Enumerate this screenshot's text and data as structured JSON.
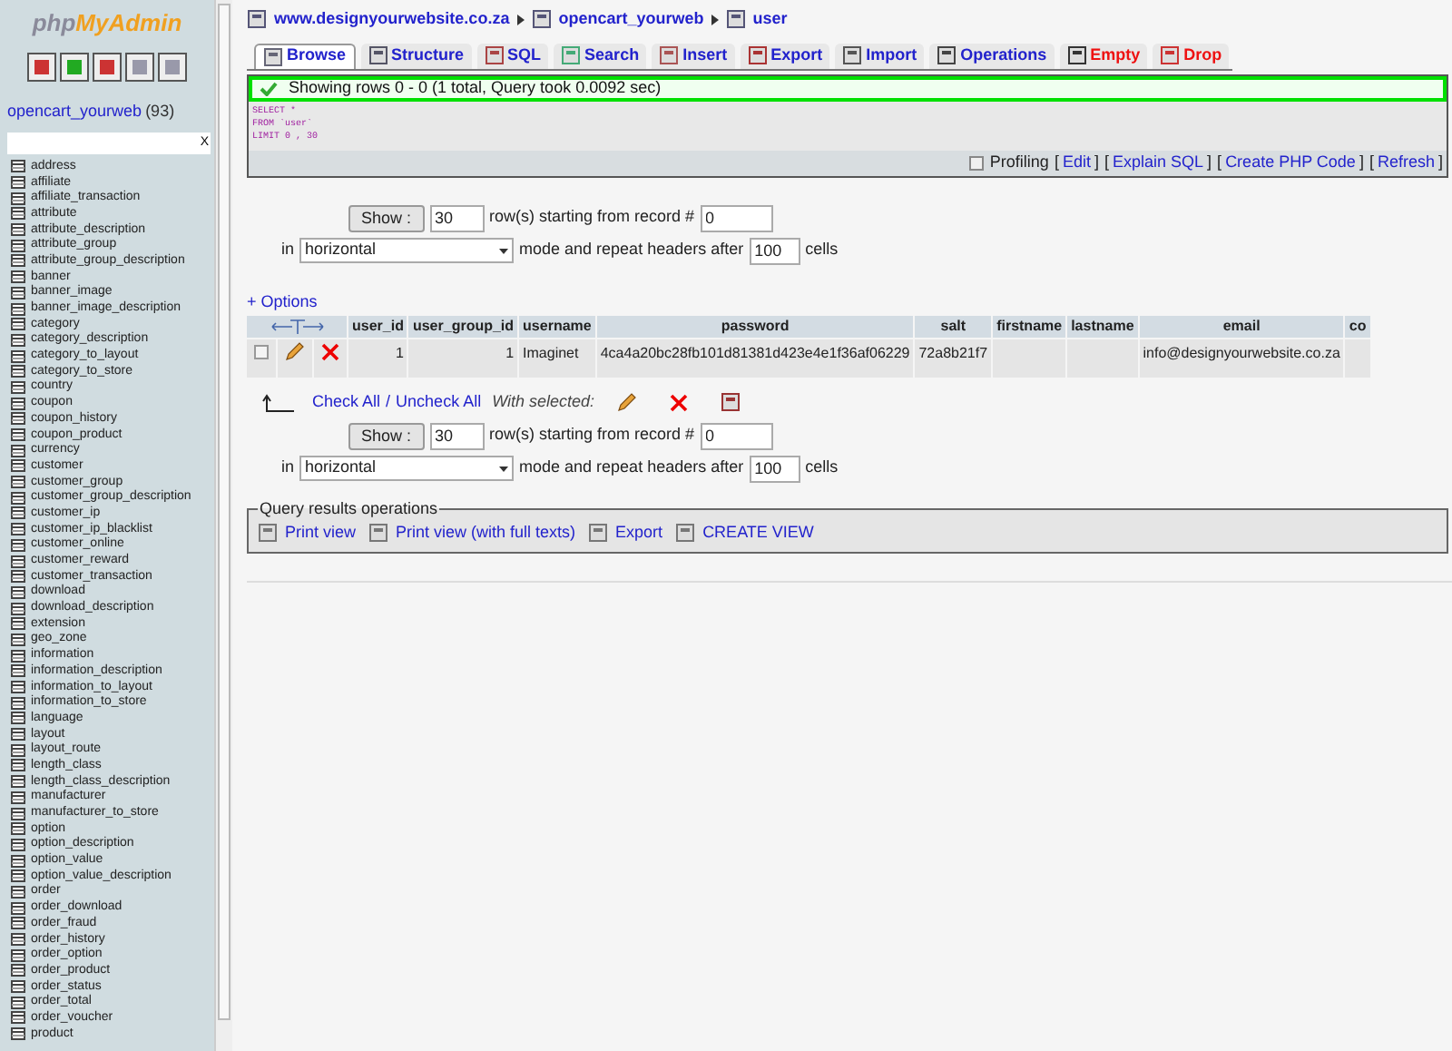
{
  "sidebar": {
    "logo": {
      "part_1": "php",
      "part_2": "MyAdmin"
    },
    "database": {
      "name": "opencart_yourweb",
      "count": "(93)"
    },
    "filter": {
      "clear": "X"
    },
    "tables": [
      "address",
      "affiliate",
      "affiliate_transaction",
      "attribute",
      "attribute_description",
      "attribute_group",
      "attribute_group_description",
      "banner",
      "banner_image",
      "banner_image_description",
      "category",
      "category_description",
      "category_to_layout",
      "category_to_store",
      "country",
      "coupon",
      "coupon_history",
      "coupon_product",
      "currency",
      "customer",
      "customer_group",
      "customer_group_description",
      "customer_ip",
      "customer_ip_blacklist",
      "customer_online",
      "customer_reward",
      "customer_transaction",
      "download",
      "download_description",
      "extension",
      "geo_zone",
      "information",
      "information_description",
      "information_to_layout",
      "information_to_store",
      "language",
      "layout",
      "layout_route",
      "length_class",
      "length_class_description",
      "manufacturer",
      "manufacturer_to_store",
      "option",
      "option_description",
      "option_value",
      "option_value_description",
      "order",
      "order_download",
      "order_fraud",
      "order_history",
      "order_option",
      "order_product",
      "order_status",
      "order_total",
      "order_voucher",
      "product"
    ]
  },
  "breadcrumb": [
    "www.designyourwebsite.co.za",
    "opencart_yourweb",
    "user"
  ],
  "tabs": [
    {
      "label": "Browse",
      "selected": true,
      "kind": "normal"
    },
    {
      "label": "Structure",
      "selected": false,
      "kind": "normal"
    },
    {
      "label": "SQL",
      "selected": false,
      "kind": "normal"
    },
    {
      "label": "Search",
      "selected": false,
      "kind": "normal"
    },
    {
      "label": "Insert",
      "selected": false,
      "kind": "normal"
    },
    {
      "label": "Export",
      "selected": false,
      "kind": "normal"
    },
    {
      "label": "Import",
      "selected": false,
      "kind": "normal"
    },
    {
      "label": "Operations",
      "selected": false,
      "kind": "normal"
    },
    {
      "label": "Empty",
      "selected": false,
      "kind": "danger"
    },
    {
      "label": "Drop",
      "selected": false,
      "kind": "danger"
    }
  ],
  "message": "Showing rows 0 - 0 (1 total, Query took 0.0092 sec)",
  "sql": [
    "SELECT *",
    "FROM `user`",
    "LIMIT 0 , 30"
  ],
  "sql_links": {
    "profiling": "Profiling",
    "checked": false,
    "links": [
      {
        "open": "[",
        "label": "Edit",
        "close": "]"
      },
      {
        "open": "[",
        "label": "Explain SQL",
        "close": "]"
      },
      {
        "open": "[",
        "label": "Create PHP Code",
        "close": "]"
      },
      {
        "open": "[",
        "label": "Refresh",
        "close": "]"
      }
    ]
  },
  "navigation": [
    {
      "show": "Show :",
      "rows": "30",
      "rows_text": "row(s) starting from record #",
      "start": "0",
      "in": "in",
      "mode": "horizontal",
      "mode_text": "mode and repeat headers after",
      "headers": "100",
      "cells": "cells"
    },
    {
      "show": "Show :",
      "rows": "30",
      "rows_text": "row(s) starting from record #",
      "start": "0",
      "in": "in",
      "mode": "horizontal",
      "mode_text": "mode and repeat headers after",
      "headers": "100",
      "cells": "cells"
    }
  ],
  "options_link": "+ Options",
  "table": {
    "columns": [
      "user_id",
      "user_group_id",
      "username",
      "password",
      "salt",
      "firstname",
      "lastname",
      "email",
      "co"
    ],
    "rows": [
      {
        "checked": false,
        "cells": [
          "1",
          "1",
          "Imaginet",
          "4ca4a20bc28fb101d81381d423e4e1f36af06229",
          "72a8b21f7",
          "",
          "",
          "info@designyourwebsite.co.za",
          ""
        ]
      }
    ]
  },
  "bulk": {
    "check_all": "Check All",
    "separator": "/",
    "uncheck_all": "Uncheck All",
    "with_selected": "With selected:"
  },
  "query_ops": {
    "legend": "Query results operations",
    "links": [
      "Print view",
      "Print view (with full texts)",
      "Export",
      "CREATE VIEW"
    ]
  }
}
